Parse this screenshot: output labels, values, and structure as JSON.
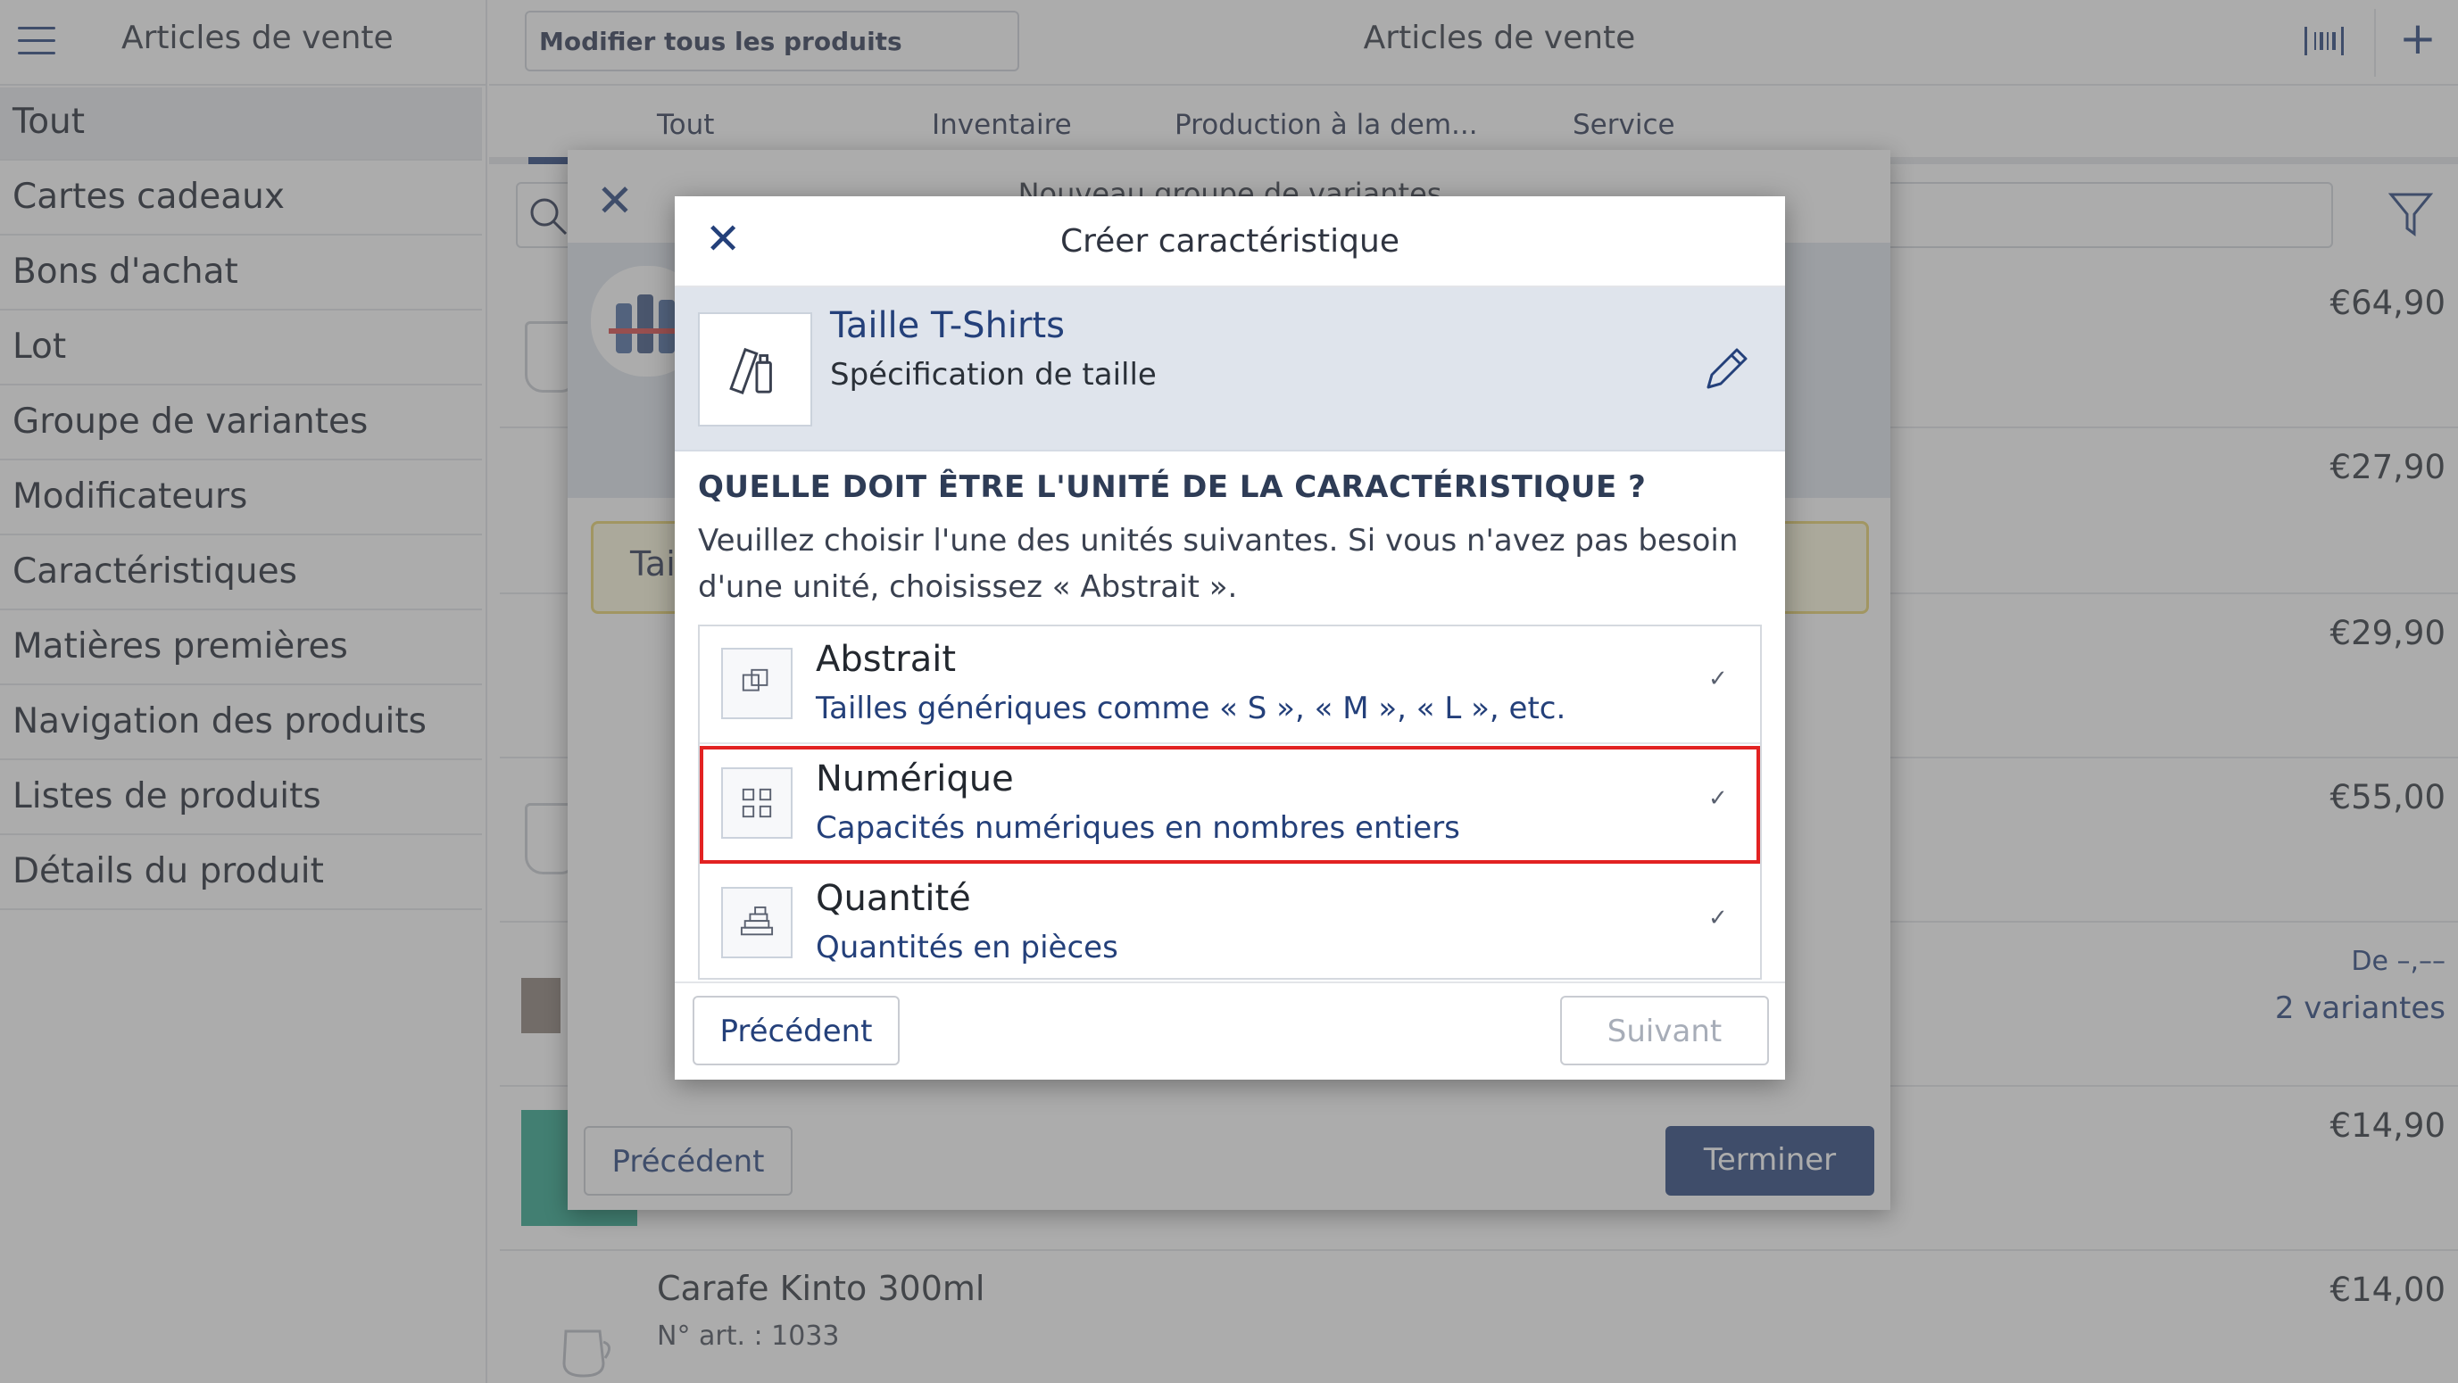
{
  "sidebar": {
    "title": "Articles de vente",
    "items": [
      {
        "label": "Tout"
      },
      {
        "label": "Cartes cadeaux"
      },
      {
        "label": "Bons d'achat"
      },
      {
        "label": "Lot"
      },
      {
        "label": "Groupe de variantes"
      },
      {
        "label": "Modificateurs"
      },
      {
        "label": "Caractéristiques"
      },
      {
        "label": "Matières premières"
      },
      {
        "label": "Navigation des produits"
      },
      {
        "label": "Listes de produits"
      },
      {
        "label": "Détails du produit"
      }
    ]
  },
  "header": {
    "edit_all_label": "Modifier tous les produits",
    "title": "Articles de vente"
  },
  "tabs": [
    "Tout",
    "Inventaire",
    "Production à la dem...",
    "Service"
  ],
  "products": [
    {
      "price": "€64,90"
    },
    {
      "price": "€27,90"
    },
    {
      "price": "€29,90"
    },
    {
      "price": "€55,00"
    },
    {
      "price_from": "De –,––",
      "variants": "2 variantes"
    },
    {
      "price": "€14,90"
    },
    {
      "name": "Carafe Kinto 300ml",
      "article": "N° art. : 1033",
      "price": "€14,00"
    }
  ],
  "variant_modal": {
    "title": "Nouveau groupe de variantes",
    "warning_text": "Tai",
    "prev_label": "Précédent",
    "finish_label": "Terminer"
  },
  "feature_modal": {
    "title": "Créer caractéristique",
    "feature_name": "Taille T-Shirts",
    "feature_desc": "Spécification de taille",
    "question_title": "QUELLE DOIT ÊTRE L'UNITÉ DE LA CARACTÉRISTIQUE ?",
    "question_text": "Veuillez choisir l'une des unités suivantes. Si vous n'avez pas besoin d'une unité, choisissez « Abstrait ».",
    "options": [
      {
        "title": "Abstrait",
        "desc": "Tailles génériques comme « S », « M », « L », etc."
      },
      {
        "title": "Numérique",
        "desc": "Capacités numériques en nombres entiers"
      },
      {
        "title": "Quantité",
        "desc": "Quantités en pièces"
      }
    ],
    "prev_label": "Précédent",
    "next_label": "Suivant"
  },
  "colors": {
    "accent": "#24407a",
    "highlight": "#e22222",
    "warning_border": "#e8d26b"
  }
}
